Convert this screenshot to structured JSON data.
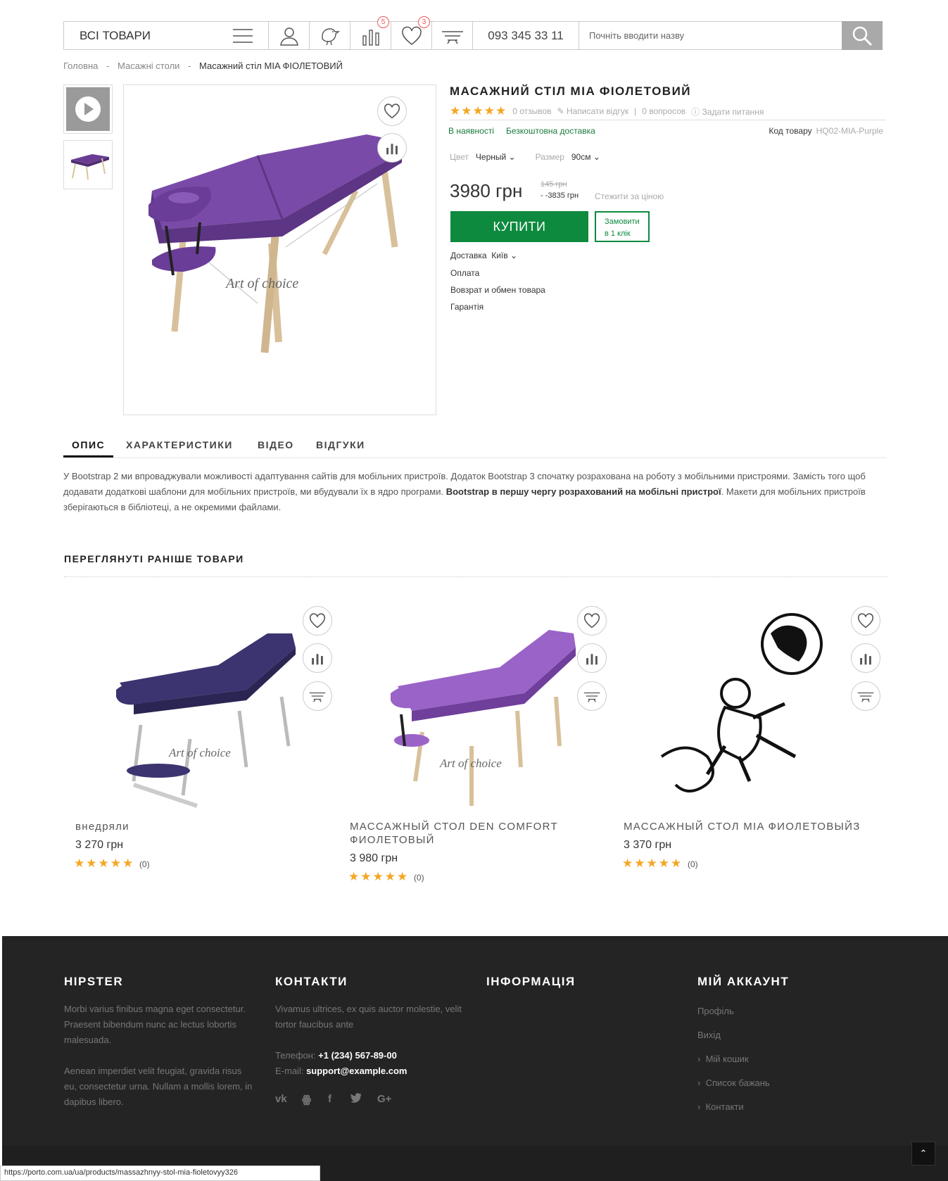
{
  "header": {
    "all_goods": "ВСІ ТОВАРИ",
    "compare_count": "5",
    "wishlist_count": "3",
    "phone": "093 345 33 11",
    "search_placeholder": "Почніть вводити назву"
  },
  "breadcrumb": {
    "home": "Головна",
    "sep": "-",
    "category": "Масажні столи",
    "current": "Масажний стіл MIA ФІОЛЕТОВИЙ"
  },
  "product": {
    "title": "МАСАЖНИЙ СТІЛ MIA ФІОЛЕТОВИЙ",
    "rating_stars": "★★★★★",
    "reviews": "0 отзывов",
    "write_review": "Написати відгук",
    "sep": "|",
    "questions": "0 вопросов",
    "ask": "Задати питання",
    "availability": "В наявності",
    "free_shipping": "Безкоштовна доставка",
    "code_label": "Код товару",
    "code_value": "HQ02-MIA-Purple",
    "color_label": "Цвет",
    "color_value": "Черный",
    "size_label": "Размер",
    "size_value": "90см",
    "price": "3980 грн",
    "old_price": "145 грн",
    "discount_price": "- -3835 грн",
    "watch_price": "Стежити за ціною",
    "buy_label": "КУПИТИ",
    "one_click_line1": "Замовити",
    "one_click_line2": "в 1 клік",
    "delivery_label": "Доставка",
    "delivery_city": "Київ",
    "payment": "Оплата",
    "returns": "Вовзрат и обмен товара",
    "warranty": "Гарантія",
    "image_watermark": "Art of choice"
  },
  "tabs": [
    "ОПИС",
    "ХАРАКТЕРИСТИКИ",
    "ВІДЕО",
    "ВІДГУКИ"
  ],
  "description": {
    "part1": "У Bootstrap 2 ми впроваджували можливості адаптування сайтів для мобільних пристроїв. Додаток Bootstrap 3 спочатку розрахована на роботу з мобільними пристроями. Замість того щоб додавати додаткові шаблони для мобільних пристроїв, ми вбудували їх в ядро програми. ",
    "bold": "Bootstrap в першу чергу розрахований на мобільні пристрої",
    "part2": ". Макети для мобільних пристроїв зберігаються в бібліотеці, а не окремими файлами."
  },
  "recently_viewed": {
    "title": "ПЕРЕГЛЯНУТІ РАНІШЕ ТОВАРИ",
    "items": [
      {
        "name": "внедряли",
        "price": "3 270 грн",
        "stars": "★★★★★",
        "count": "(0)",
        "color": "#3b3470"
      },
      {
        "name": "МАССАЖНЫЙ СТОЛ DEN COMFORT ФИОЛЕТОВЫЙ",
        "price": "3 980 грн",
        "stars": "★★★★★",
        "count": "(0)",
        "color": "#8f5bbd"
      },
      {
        "name": "МАССАЖНЫЙ СТОЛ MIA ФИОЛЕТОВЫЙЗ",
        "price": "3 370 грн",
        "stars": "★★★★★",
        "count": "(0)",
        "color": "#111111"
      }
    ]
  },
  "footer": {
    "col1_title": "HIPSTER",
    "col1_text1": "Morbi varius finibus magna eget consectetur. Praesent bibendum nunc ac lectus lobortis malesuada.",
    "col1_text2": "Aenean imperdiet velit feugiat, gravida risus eu, consectetur urna. Nullam a mollis lorem, in dapibus libero.",
    "col2_title": "КОНТАКТИ",
    "col2_text": "Vivamus ultrices, ex quis auctor molestie, velit tortor faucibus ante",
    "phone_label": "Телефон: ",
    "phone_value": "+1 (234) 567-89-00",
    "email_label": "E-mail: ",
    "email_value": "support@example.com",
    "col3_title": "ІНФОРМАЦІЯ",
    "col4_title": "МІЙ АККАУНТ",
    "links": [
      "Профіль",
      "Вихід",
      "Мій кошик",
      "Список бажань",
      "Контакти"
    ],
    "social": [
      "vk",
      "ok",
      "f",
      "twitter",
      "G+"
    ]
  },
  "status_url": "https://porto.com.ua/ua/products/massazhnyy-stol-mia-fioletovyy326",
  "colors": {
    "accent_green": "#0d8a3e",
    "star": "#f5a623",
    "badge": "#e55555",
    "footer_bg": "#242424"
  }
}
